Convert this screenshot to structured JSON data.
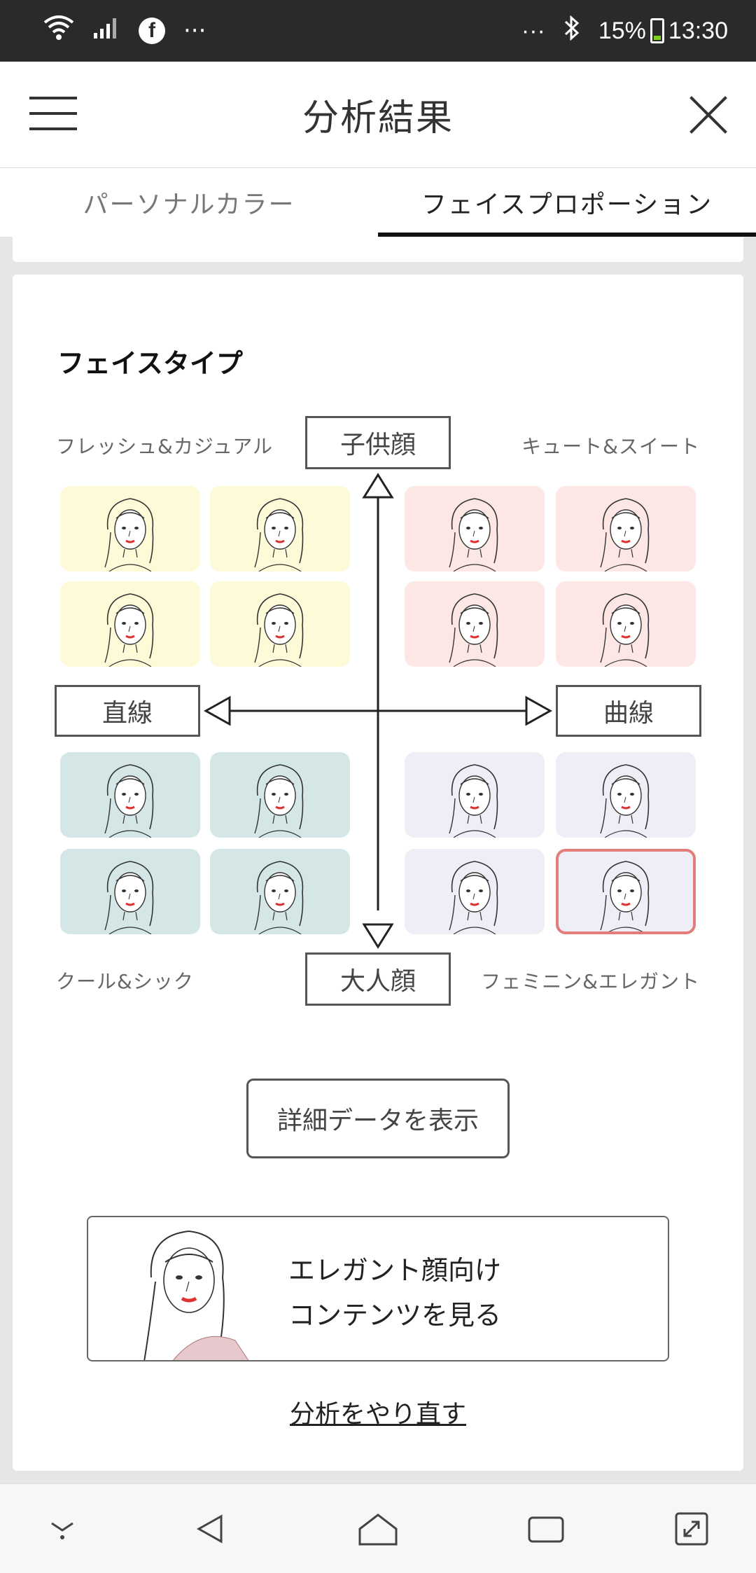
{
  "status_bar": {
    "battery": "15%",
    "time": "13:30",
    "dots_left": "···",
    "dots_right": "···"
  },
  "header": {
    "title": "分析結果"
  },
  "tabs": [
    {
      "label": "パーソナルカラー",
      "active": false
    },
    {
      "label": "フェイスプロポーション",
      "active": true
    }
  ],
  "face_type": {
    "section_title": "フェイスタイプ",
    "axis_top": "子供顔",
    "axis_bottom": "大人顔",
    "axis_left": "直線",
    "axis_right": "曲線",
    "corner_top_left": "フレッシュ&カジュアル",
    "corner_top_right": "キュート&スイート",
    "corner_bottom_left": "クール&シック",
    "corner_bottom_right": "フェミニン&エレガント",
    "selected_quadrant": "フェミニン&エレガント",
    "quadrant_colors": {
      "fresh_casual": "#fdfad8",
      "cute_sweet": "#fde7e5",
      "cool_chic": "#d4e6e6",
      "feminine_elegant": "#eeeef7",
      "selected_border": "#e27d7a"
    }
  },
  "detail_button": "詳細データを表示",
  "content_banner": {
    "line1": "エレガント顔向け",
    "line2": "コンテンツを見る"
  },
  "redo_link": "分析をやり直す"
}
